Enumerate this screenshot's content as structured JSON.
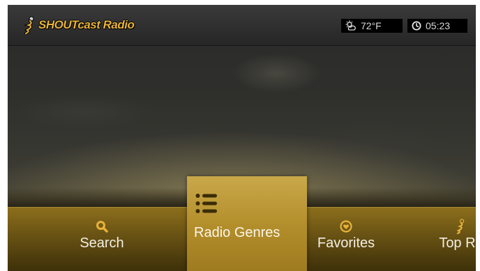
{
  "app": {
    "title": "SHOUTcast Radio"
  },
  "status": {
    "temperature": "72°F",
    "time": "05:23",
    "weather_icon": "partly-cloudy-icon",
    "clock_icon": "clock-icon"
  },
  "menu": {
    "items": [
      {
        "label": "Search",
        "icon": "search-icon"
      },
      {
        "label": "Radio Genres",
        "icon": "list-icon"
      },
      {
        "label": "Favorites",
        "icon": "heart-icon"
      },
      {
        "label": "Top Ra",
        "icon": "microphone-icon"
      }
    ],
    "selected_index": 1
  },
  "colors": {
    "accent": "#b48f2c",
    "logo": "#e8b33a",
    "strip": "#6b5414"
  }
}
